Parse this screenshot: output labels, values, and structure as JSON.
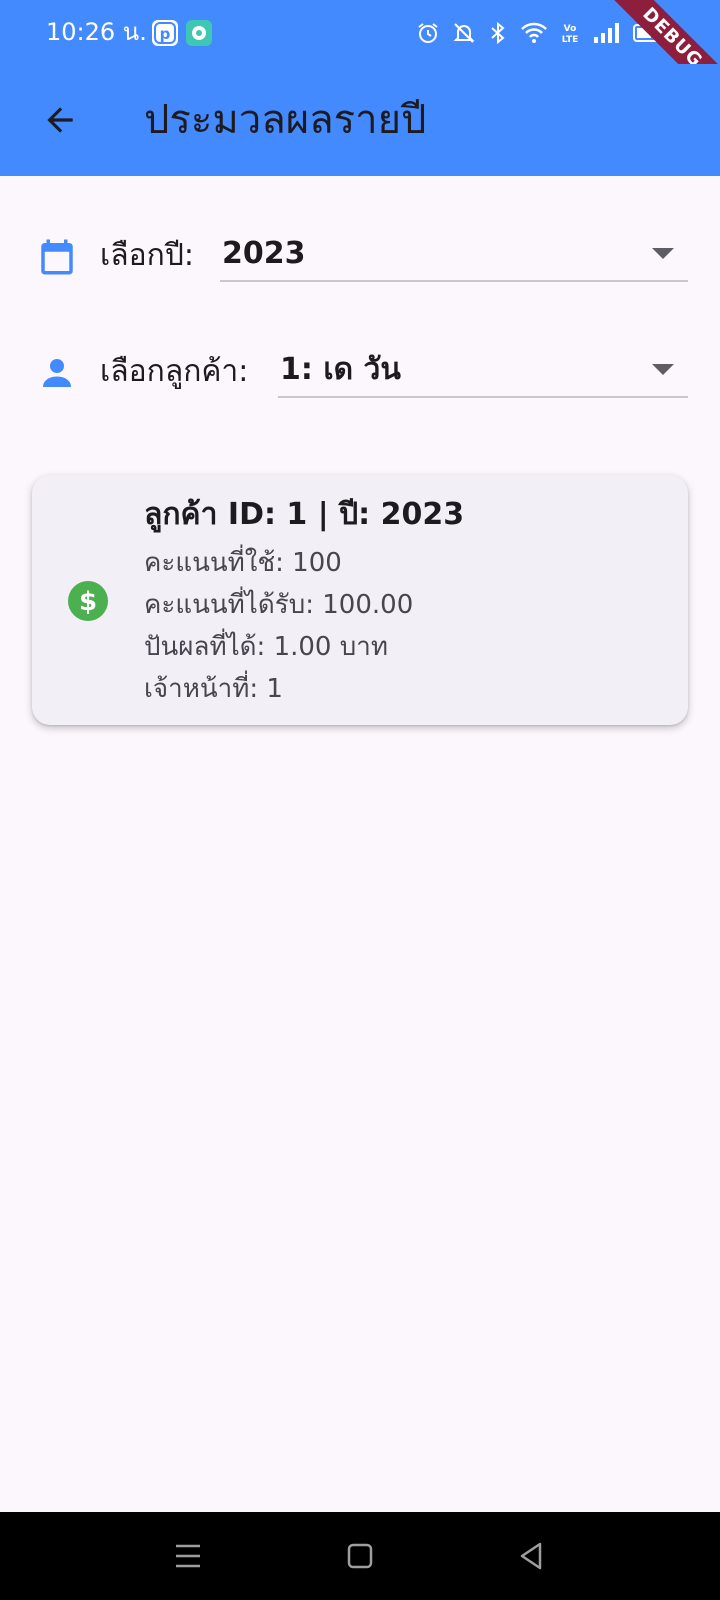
{
  "status_bar": {
    "time": "10:26 น.",
    "debug_banner": "DEBUG",
    "icons": [
      "pinned-note-icon",
      "chat-app-icon",
      "alarm-icon",
      "mute-bell-icon",
      "bluetooth-icon",
      "wifi-icon",
      "volte-icon",
      "signal-icon",
      "battery-icon"
    ]
  },
  "app_bar": {
    "title": "ประมวลผลรายปี",
    "back_icon": "arrow-back-icon"
  },
  "year_selector": {
    "label": "เลือกปี:",
    "value": "2023",
    "icon": "calendar-icon"
  },
  "customer_selector": {
    "label": "เลือกลูกค้า:",
    "value": "1: เด วัน",
    "icon": "person-icon"
  },
  "result_card": {
    "title": "ลูกค้า ID: 1 | ปี: 2023",
    "points_used": "คะแนนที่ใช้: 100",
    "points_earned": "คะแนนที่ได้รับ: 100.00",
    "dividend": "ปันผลที่ได้: 1.00 บาท",
    "officer": "เจ้าหน้าที่: 1",
    "icon": "dollar-icon"
  },
  "nav_bar": {
    "buttons": [
      "menu-icon",
      "home-square-icon",
      "back-triangle-icon"
    ]
  },
  "colors": {
    "primary": "#448aff",
    "background": "#fcf6fd",
    "card": "#f3eff6",
    "money_green": "#4caf50",
    "debug": "#8e1f3c"
  }
}
